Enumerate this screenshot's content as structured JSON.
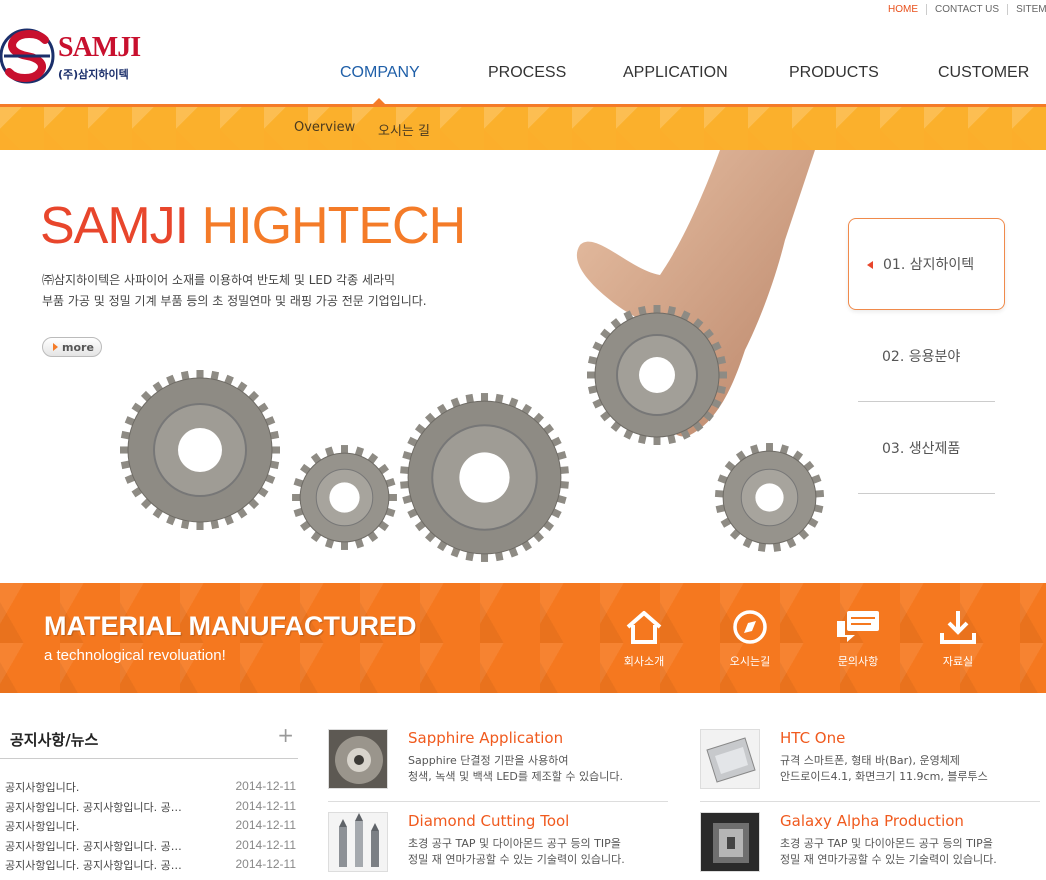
{
  "utility": {
    "home": "HOME",
    "contact": "CONTACT US",
    "sitemap": "SITEMAP"
  },
  "logo": {
    "name": "SAMJI",
    "sub": "(주)삼지하이텍"
  },
  "nav": {
    "company": "COMPANY",
    "process": "PROCESS",
    "application": "APPLICATION",
    "products": "PRODUCTS",
    "customer": "CUSTOMER"
  },
  "subnav": {
    "overview": "Overview",
    "directions": "오시는 길"
  },
  "hero": {
    "title_a": "SAMJI",
    "title_b": "HIGHTECH",
    "desc1": "㈜삼지하이텍은 사파이어 소재를 이용하여 반도체 및 LED 각종 세라믹",
    "desc2": "부품 가공 및 정밀 기계 부품 등의 초 정밀연마 및 래핑 가공 전문 기업입니다.",
    "more": "more"
  },
  "side_tabs": [
    "01. 삼지하이텍",
    "02. 응용분야",
    "03. 생산제품"
  ],
  "banner": {
    "title": "MATERIAL MANUFACTURED",
    "subtitle": "a technological revoluation!",
    "links": [
      "회사소개",
      "오시는길",
      "문의사항",
      "자료실"
    ]
  },
  "notice": {
    "title": "공지사항/뉴스",
    "plus": "+",
    "items": [
      {
        "title": "공지사항입니다.",
        "date": "2014-12-11"
      },
      {
        "title": "공지사항입니다. 공지사항입니다. 공…",
        "date": "2014-12-11"
      },
      {
        "title": "공지사항입니다.",
        "date": "2014-12-11"
      },
      {
        "title": "공지사항입니다. 공지사항입니다. 공…",
        "date": "2014-12-11"
      },
      {
        "title": "공지사항입니다. 공지사항입니다. 공…",
        "date": "2014-12-11"
      }
    ]
  },
  "products": [
    {
      "title": "Sapphire Application",
      "desc1": "Sapphire 단결정 기판을 사용하여",
      "desc2": "청색, 녹색 및 백색 LED를 제조할 수 있습니다."
    },
    {
      "title": "HTC One",
      "desc1": "규격 스마트폰, 형태 바(Bar), 운영체제",
      "desc2": "안드로이드4.1, 화면크기 11.9cm, 블루투스"
    },
    {
      "title": "Diamond Cutting Tool",
      "desc1": "초경 공구 TAP 및 다이아몬드 공구 등의 TIP을",
      "desc2": "정밀 재 연마가공할 수 있는 기술력이 있습니다."
    },
    {
      "title": "Galaxy Alpha Production",
      "desc1": "초경 공구 TAP 및 다이아몬드 공구 등의 TIP을",
      "desc2": "정밀 재 연마가공할 수 있는 기술력이 있습니다."
    }
  ],
  "colors": {
    "accent": "#f47b28",
    "title_red": "#e8462c",
    "nav_active": "#1f5fa8",
    "banner": "#f5781f"
  }
}
